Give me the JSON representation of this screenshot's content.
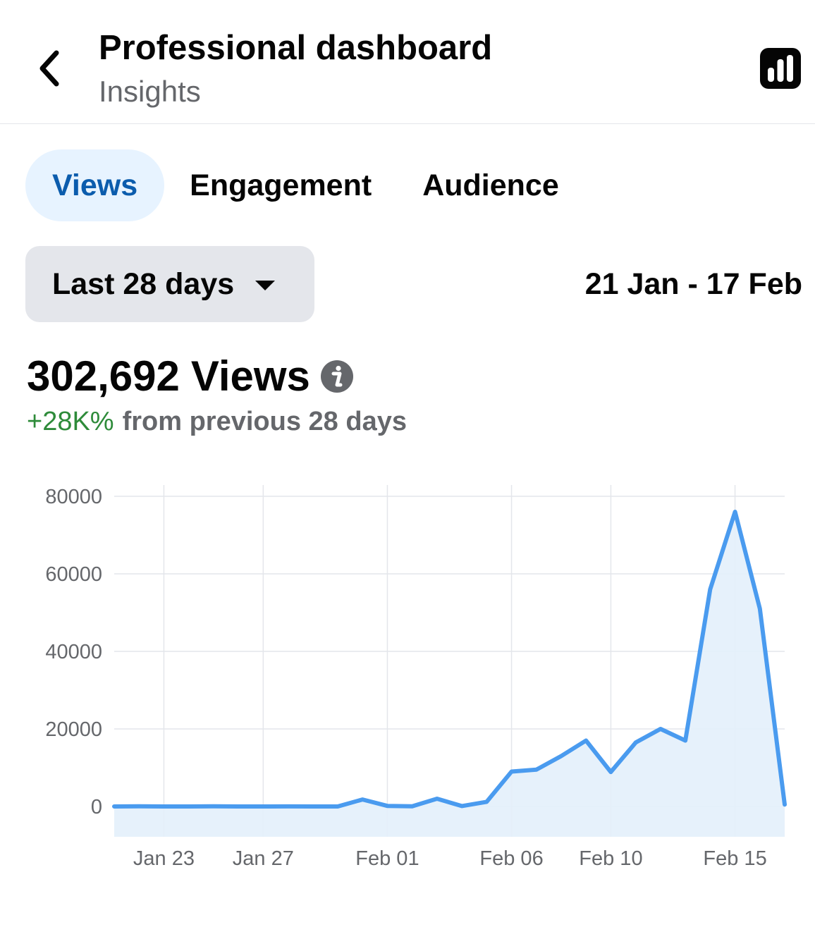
{
  "header": {
    "title": "Professional dashboard",
    "subtitle": "Insights",
    "back_icon": "chevron-left-icon",
    "insights_icon": "bar-chart-icon"
  },
  "tabs": [
    {
      "label": "Views",
      "active": true
    },
    {
      "label": "Engagement",
      "active": false
    },
    {
      "label": "Audience",
      "active": false
    }
  ],
  "filter": {
    "range_label": "Last 28 days",
    "date_range": "21 Jan - 17 Feb"
  },
  "metric": {
    "value": "302,692",
    "label": "Views",
    "change_pct": "+28K%",
    "change_text": "from previous 28 days"
  },
  "colors": {
    "accent": "#0b5cad",
    "tab_active_bg": "#e7f3ff",
    "positive": "#2e8b3a",
    "line": "#4a9bef",
    "area": "#e3effb"
  },
  "chart_data": {
    "type": "area",
    "x": [
      "Jan 21",
      "Jan 22",
      "Jan 23",
      "Jan 24",
      "Jan 25",
      "Jan 26",
      "Jan 27",
      "Jan 28",
      "Jan 29",
      "Jan 30",
      "Jan 31",
      "Feb 01",
      "Feb 02",
      "Feb 03",
      "Feb 04",
      "Feb 05",
      "Feb 06",
      "Feb 07",
      "Feb 08",
      "Feb 09",
      "Feb 10",
      "Feb 11",
      "Feb 12",
      "Feb 13",
      "Feb 14",
      "Feb 15",
      "Feb 16",
      "Feb 17"
    ],
    "values": [
      0,
      50,
      0,
      0,
      30,
      0,
      0,
      20,
      0,
      0,
      1800,
      150,
      50,
      2000,
      100,
      1200,
      9000,
      9500,
      13000,
      17000,
      8900,
      16500,
      20000,
      17000,
      56000,
      76000,
      51000,
      500
    ],
    "xticks": [
      "Jan 23",
      "Jan 27",
      "Feb 01",
      "Feb 06",
      "Feb 10",
      "Feb 15"
    ],
    "yticks": [
      "80000",
      "60000",
      "40000",
      "20000",
      "0"
    ],
    "ylim": [
      -8000,
      80000
    ],
    "grid": true
  }
}
